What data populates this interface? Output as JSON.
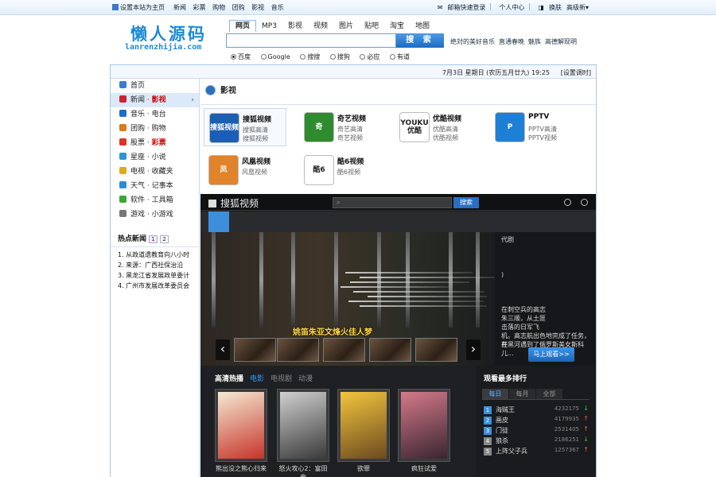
{
  "topbar": {
    "sethome": "设置本站为主页",
    "links": [
      "新闻",
      "彩票",
      "购物",
      "团购",
      "影视",
      "音乐"
    ],
    "right": [
      "邮箱快速登录",
      "个人中心",
      "换肤",
      "高级新▾"
    ]
  },
  "logo": {
    "cn": "懒人源码",
    "en": "lanrenzhijia.com"
  },
  "search": {
    "tabs": [
      "网页",
      "MP3",
      "影视",
      "视频",
      "图片",
      "贴吧",
      "淘宝",
      "地图"
    ],
    "active_tab": "网页",
    "placeholder": "",
    "button": "搜 索",
    "hotwords": [
      "绝対的美好音乐",
      "直通春晚",
      "魅族",
      "高德解现明"
    ],
    "engines": [
      "百度",
      "Google",
      "搜搜",
      "搜狗",
      "必应",
      "有道"
    ],
    "selected_engine": "百度"
  },
  "datebar": {
    "date": "7月3日 星期日 (农历五月廿九) 19:25",
    "settings": "[设置调时]"
  },
  "sidebar": {
    "items": [
      {
        "label": "首页",
        "extra": "",
        "color": "#3b7bd4"
      },
      {
        "label": "新闻 · ",
        "extra": "影视",
        "color": "#c23"
      },
      {
        "label": "音乐 · 电台",
        "extra": "",
        "color": "#1d6cc8"
      },
      {
        "label": "团购 · 购物",
        "extra": "",
        "color": "#e07b14"
      },
      {
        "label": "股票 · ",
        "extra": "彩票",
        "color": "#d32"
      },
      {
        "label": "星座 · 小说",
        "extra": "",
        "color": "#2b93d6"
      },
      {
        "label": "电视 · 收藏夹",
        "extra": "",
        "color": "#e1a91c"
      },
      {
        "label": "天气 · 记事本",
        "extra": "",
        "color": "#2b8be0"
      },
      {
        "label": "软件 · 工具箱",
        "extra": "",
        "color": "#3aa63a"
      },
      {
        "label": "游戏 · 小游戏",
        "extra": "",
        "color": "#777"
      }
    ],
    "active_index": 1,
    "arrow": "›"
  },
  "hotnews": {
    "title": "热点新闻",
    "pages": [
      "1",
      "2"
    ],
    "items": [
      "1. 从政道遗教育向八小时",
      "2. 来源：广西社保治沿",
      "3. 黑龙江省发展政单委计",
      "4. 广州市发展改革委员会"
    ]
  },
  "content": {
    "section": "影视",
    "sites": [
      {
        "name": "搜狐视频",
        "a": "搜狐高清",
        "b": "搜狐视频",
        "color": "#1a5fb4",
        "logo_text": "搜狐视频"
      },
      {
        "name": "奇艺视频",
        "a": "奇艺高清",
        "b": "奇艺视频",
        "color": "#2e8b2e",
        "logo_text": "奇"
      },
      {
        "name": "优酷视频",
        "a": "优酷高清",
        "b": "优酷视频",
        "color": "#ffffff",
        "logo_text": "YOUKU优酷"
      },
      {
        "name": "PPTV",
        "a": "PPTV高清",
        "b": "PPTV视频",
        "color": "#1e7fd6",
        "logo_text": "P"
      },
      {
        "name": "风凰视频",
        "a": "风凰视频",
        "b": "",
        "color": "#e0832a",
        "logo_text": "凤"
      },
      {
        "name": "酷6视频",
        "a": "酷6视频",
        "b": "",
        "color": "#ffffff",
        "logo_text": "酷6"
      }
    ]
  },
  "player": {
    "brand": "搜狐视频",
    "search_btn": "搜索",
    "caption": "姚笛朱亚文烽火佳人梦",
    "info": [
      "代剧",
      "",
      ")",
      "",
      "在刺空兵的高志",
      "朱三顺，从土匪",
      "击落的日军飞",
      "机。高志航出色地完成了任务，并",
      "在黑河遇到了俄罗斯美女斯科儿..."
    ],
    "play_btn": "马上观看>>",
    "prev": "‹",
    "next": "›"
  },
  "hot": {
    "title": "高清热播",
    "tabs": [
      "电影",
      "电视剧",
      "动漫"
    ],
    "posters": [
      {
        "title": "熊出没之熊心归来",
        "c1": "#f4e9d2",
        "c2": "#c7342a"
      },
      {
        "title": "怒火攻心2：富田电",
        "c1": "#cfcfcf",
        "c2": "#3a3a3a"
      },
      {
        "title": "欲罪",
        "c1": "#f2c53d",
        "c2": "#6b4a1f"
      },
      {
        "title": "疯狂试爱",
        "c1": "#d47a8b",
        "c2": "#3a2530"
      }
    ]
  },
  "ranking": {
    "title": "观看最多排行",
    "tabs": [
      "每日",
      "每月",
      "全部"
    ],
    "items": [
      {
        "n": "1",
        "name": "海贼王",
        "count": "4232175",
        "trend": "↓",
        "tc": "#3c3"
      },
      {
        "n": "2",
        "name": "画皮",
        "count": "4179935",
        "trend": "↑",
        "tc": "#e63"
      },
      {
        "n": "3",
        "name": "门徒",
        "count": "2531405",
        "trend": "↑",
        "tc": "#e63"
      },
      {
        "n": "4",
        "name": "狼杀",
        "count": "2186251",
        "trend": "↓",
        "tc": "#3c3"
      },
      {
        "n": "5",
        "name": "上阵父子兵",
        "count": "1257367",
        "trend": "↑",
        "tc": "#e63"
      }
    ]
  }
}
